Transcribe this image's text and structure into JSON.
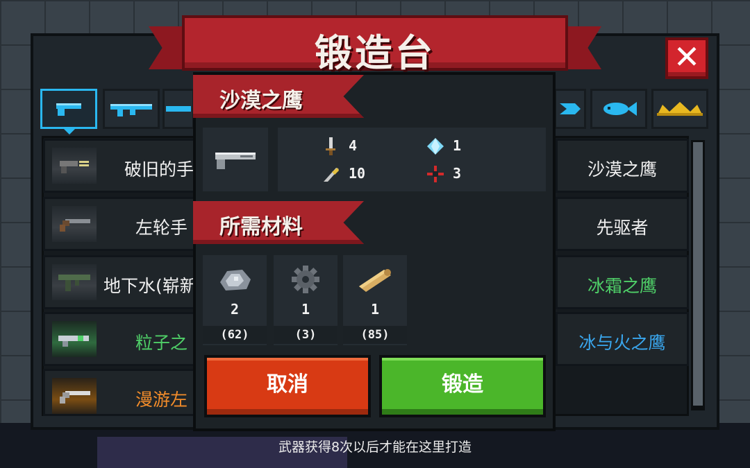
{
  "title": "锻造台",
  "close_label": "✕",
  "tabs": [
    {
      "name": "pistol-tab-icon",
      "color": "#2ab8f0",
      "selected": true
    },
    {
      "name": "rifle-tab-icon",
      "color": "#2ab8f0"
    },
    {
      "name": "shotgun-tab-icon",
      "color": "#2ab8f0"
    },
    {
      "name": "launcher-tab-icon",
      "color": "#2ab8f0"
    },
    {
      "name": "fish-tab-icon",
      "color": "#2ab8f0"
    },
    {
      "name": "crown-tab-icon",
      "color": "#e8b820"
    }
  ],
  "weapons_left": [
    {
      "name": "破旧的手",
      "color": "#f0f0f0"
    },
    {
      "name": "左轮手",
      "color": "#f0f0f0"
    },
    {
      "name": "地下水(崭新",
      "color": "#f0f0f0"
    },
    {
      "name": "粒子之",
      "color": "#4fd068"
    },
    {
      "name": "漫游左",
      "color": "#f28c2a"
    }
  ],
  "weapons_right": [
    {
      "name": "沙漠之鹰",
      "color": "#f0f0f0"
    },
    {
      "name": "先驱者",
      "color": "#f0f0f0"
    },
    {
      "name": "冰霜之鹰",
      "color": "#4fd068"
    },
    {
      "name": "冰与火之鹰",
      "color": "#3aa7ee"
    }
  ],
  "detail": {
    "weapon_name": "沙漠之鹰",
    "stats": {
      "damage": "4",
      "energy": "1",
      "accuracy": "10",
      "crit": "3"
    },
    "materials_title": "所需材料",
    "materials": [
      {
        "icon": "ore-icon",
        "required": "2",
        "owned": "(62)"
      },
      {
        "icon": "gear-icon",
        "required": "1",
        "owned": "(3)"
      },
      {
        "icon": "wood-icon",
        "required": "1",
        "owned": "(85)"
      }
    ],
    "cancel_label": "取消",
    "forge_label": "锻造"
  },
  "hint": "武器获得8次以后才能在这里打造",
  "colors": {
    "ribbon": "#b3252d",
    "cancel": "#d83a14",
    "forge": "#4bb62a",
    "tab_highlight": "#2ab8f0"
  }
}
